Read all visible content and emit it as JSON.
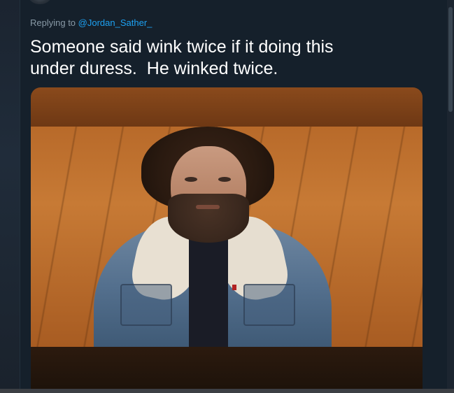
{
  "reply": {
    "prefix": "Replying to",
    "handle": "@Jordan_Sather_"
  },
  "tweet": {
    "text": "Someone said wink twice if it doing this\nunder duress.  He winked twice."
  },
  "media": {
    "type": "video",
    "description_icon": "video-frame"
  },
  "colors": {
    "background": "#15202b",
    "link": "#1da1f2",
    "secondary_text": "#8899a6",
    "primary_text": "#ffffff"
  }
}
